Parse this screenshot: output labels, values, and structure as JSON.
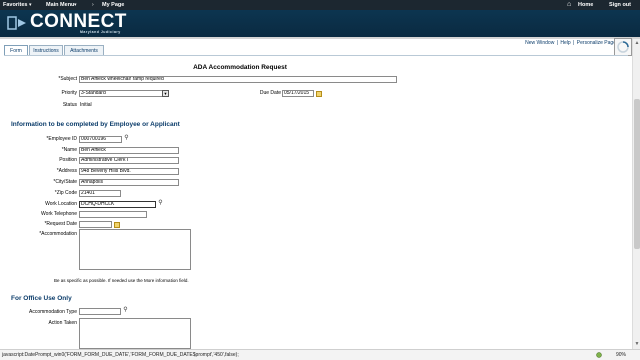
{
  "topnav": {
    "favorites": "Favorites",
    "main_menu": "Main Menu",
    "my_page": "My Page",
    "home": "Home",
    "sign_out": "Sign out"
  },
  "header": {
    "logo": "CONNECT",
    "logo_sub": "Maryland Judiciary"
  },
  "toplinks": [
    "New Window",
    "|",
    "Help",
    "|",
    "Personalize Page"
  ],
  "tabs": [
    "Form",
    "Instructions",
    "Attachments"
  ],
  "form": {
    "title": "ADA Accommodation Request",
    "subject_label": "*Subject",
    "subject_value": "Ben Affleck wheelchair ramp required",
    "priority_label": "Priority",
    "priority_value": "3-Standard",
    "due_date_label": "Due Date",
    "due_date_value": "05/17/2015",
    "status_label": "Status",
    "status_value": "Initial"
  },
  "employee_section": {
    "heading": "Information to be completed by Employee or Applicant",
    "employee_id_label": "*Employee ID",
    "employee_id_value": "000700196",
    "name_label": "*Name",
    "name_value": "Ben Affleck",
    "position_label": "Position",
    "position_value": "Administrative Clerk I",
    "address_label": "*Address",
    "address_value": "948 Beverly Hills Blvd.",
    "city_state_label": "*City/State",
    "city_state_value": "Annapolis",
    "zip_label": "*Zip Code",
    "zip_value": "21401",
    "work_location_label": "Work Location",
    "work_location_value": "DCHQ-DHCLK",
    "work_telephone_label": "Work Telephone",
    "work_telephone_value": "",
    "request_date_label": "*Request Date",
    "request_date_value": "",
    "accommodation_label": "*Accommodation",
    "hint": "Be as specific as possible. If needed use the More information field."
  },
  "office_section": {
    "heading": "For Office Use Only",
    "accommodation_type_label": "Accommodation Type",
    "accommodation_type_value": "",
    "action_taken_label": "Action Taken"
  },
  "statusbar": {
    "text": "javascript:DatePrompt_win0('FORM_FORM_DUE_DATE','FORM_FORM_DUE_DATE$prompt','450',false);",
    "zoom": "90%"
  },
  "colors": {
    "header_bg": "#0c3550",
    "topnav_bg": "#1c2730",
    "section_heading": "#0b3c6a"
  }
}
